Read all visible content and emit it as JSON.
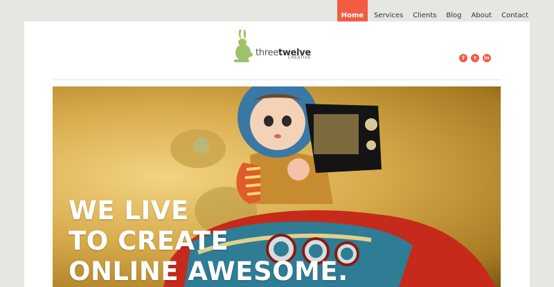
{
  "nav": {
    "items": [
      {
        "label": "Home",
        "active": true
      },
      {
        "label": "Services",
        "active": false
      },
      {
        "label": "Clients",
        "active": false
      },
      {
        "label": "Blog",
        "active": false
      },
      {
        "label": "About",
        "active": false
      },
      {
        "label": "Contact",
        "active": false
      }
    ]
  },
  "brand": {
    "word_light": "three",
    "word_bold": "twelve",
    "sub": "CREATIVE",
    "accent": "#f25c41",
    "logo_color": "#9ec26a"
  },
  "social": [
    {
      "icon": "facebook-icon",
      "glyph": "f"
    },
    {
      "icon": "twitter-icon",
      "glyph": "t"
    },
    {
      "icon": "linkedin-icon",
      "glyph": "in"
    }
  ],
  "hero": {
    "lines": [
      "WE LIVE",
      "TO CREATE",
      "ONLINE AWESOME."
    ]
  }
}
